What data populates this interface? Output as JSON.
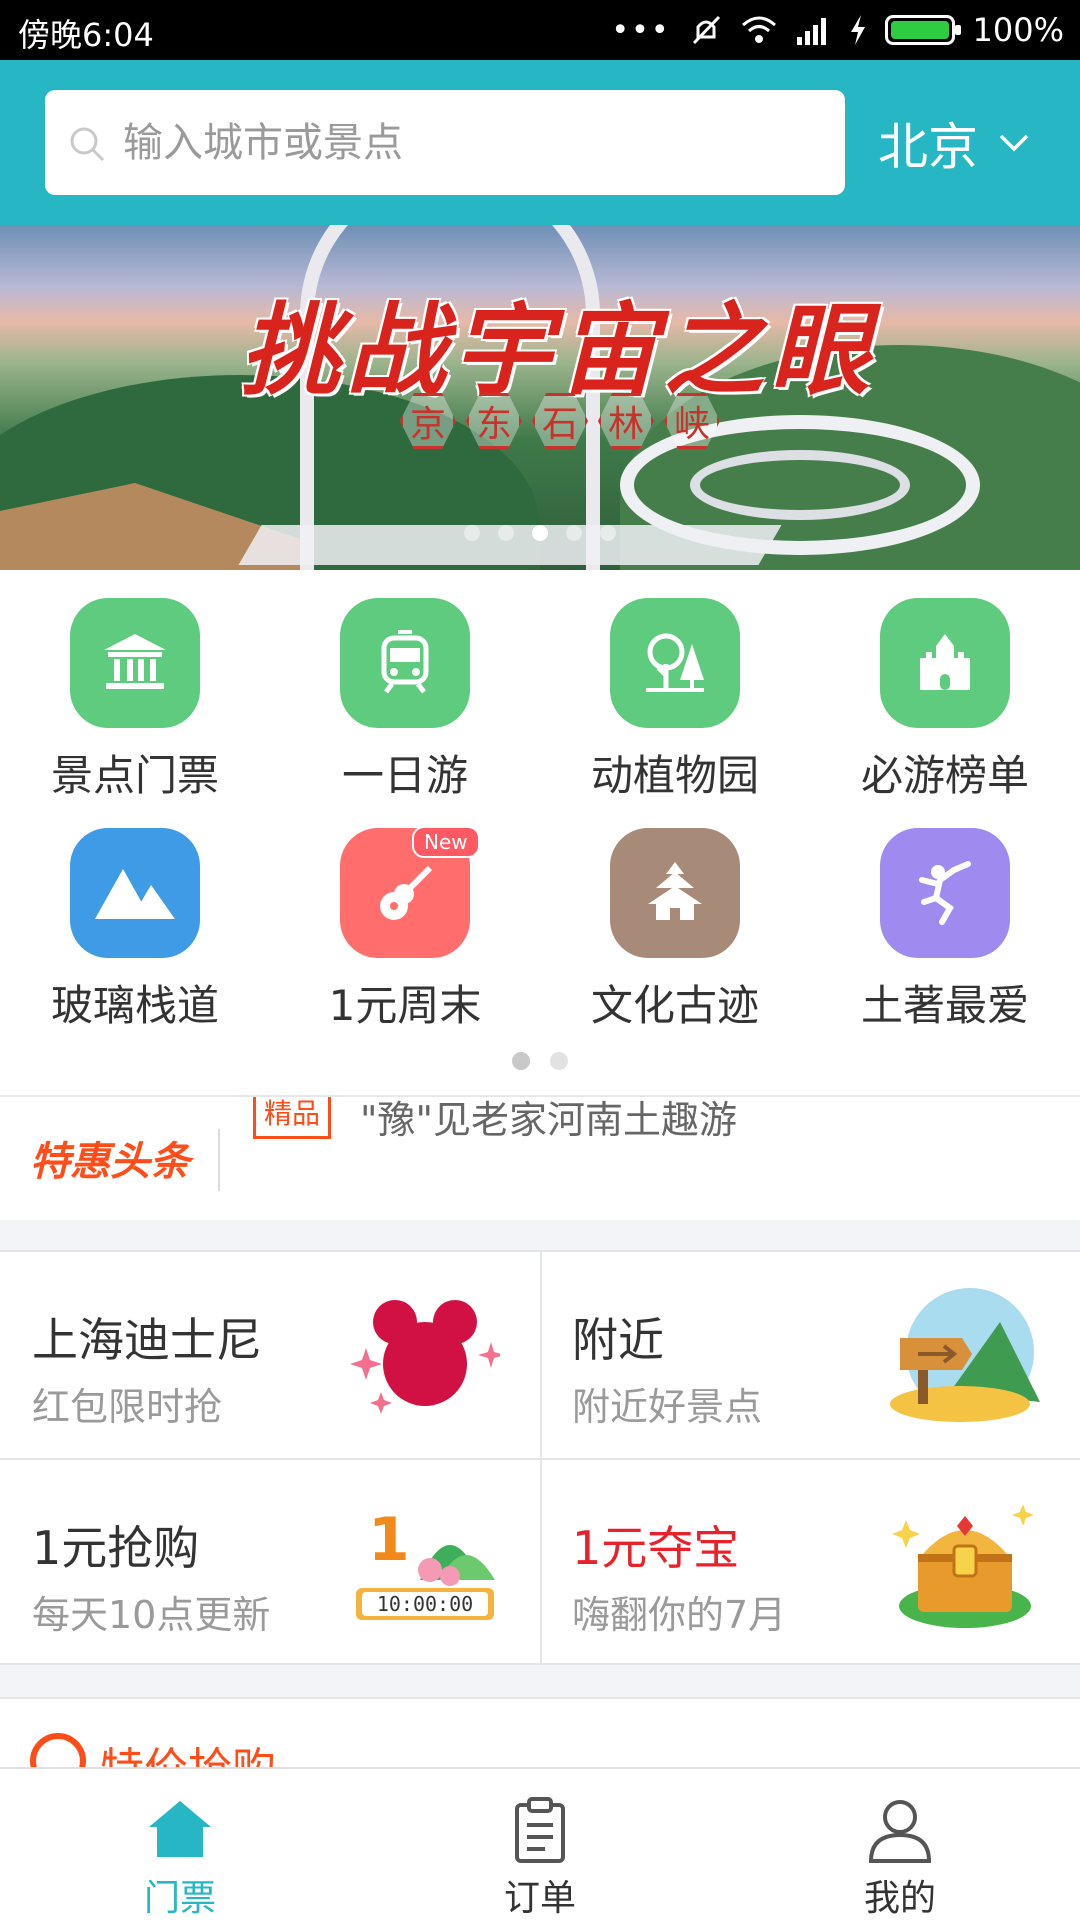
{
  "status_bar": {
    "time": "傍晚6:04",
    "signal_dots": "•••",
    "battery": "100%"
  },
  "header": {
    "search_placeholder": "输入城市或景点",
    "city": "北京"
  },
  "banner": {
    "title": "挑战宇宙之眼",
    "subtitle_chars": [
      "京",
      "东",
      "石",
      "林",
      "峡"
    ],
    "page_count": 5,
    "active_page": 3
  },
  "categories": [
    {
      "label": "景点门票",
      "icon": "temple-icon",
      "color": "#5ecb7e"
    },
    {
      "label": "一日游",
      "icon": "bus-icon",
      "color": "#5ecb7e"
    },
    {
      "label": "动植物园",
      "icon": "tree-icon",
      "color": "#5ecb7e"
    },
    {
      "label": "必游榜单",
      "icon": "castle-icon",
      "color": "#5ecb7e"
    },
    {
      "label": "玻璃栈道",
      "icon": "mountain-icon",
      "color": "#3f9be6"
    },
    {
      "label": "1元周末",
      "icon": "guitar-icon",
      "color": "#ff6d6d",
      "badge": "New"
    },
    {
      "label": "文化古迹",
      "icon": "pagoda-icon",
      "color": "#a88a78"
    },
    {
      "label": "土著最爱",
      "icon": "dancer-icon",
      "color": "#9f8bf0"
    }
  ],
  "grid_pager": {
    "pages": 2,
    "active": 1
  },
  "headline": {
    "brand": "特惠头条",
    "tag": "精品",
    "text": "\"豫\"见老家河南土趣游"
  },
  "promos": [
    {
      "title": "上海迪士尼",
      "subtitle": "红包限时抢",
      "icon": "mickey-icon",
      "title_color": "#333333"
    },
    {
      "title": "附近",
      "subtitle": "附近好景点",
      "icon": "signpost-icon",
      "title_color": "#333333"
    },
    {
      "title": "1元抢购",
      "subtitle": "每天10点更新",
      "icon": "timer-icon",
      "title_color": "#333333",
      "timer": "10:00:00"
    },
    {
      "title": "1元夺宝",
      "subtitle": "嗨翻你的7月",
      "icon": "treasure-chest-icon",
      "title_color": "#e8212a"
    }
  ],
  "section": {
    "title": "特价抢购"
  },
  "bottom_nav": [
    {
      "label": "门票",
      "icon": "home-icon",
      "active": true
    },
    {
      "label": "订单",
      "icon": "clipboard-icon",
      "active": false
    },
    {
      "label": "我的",
      "icon": "user-icon",
      "active": false
    }
  ],
  "colors": {
    "accent": "#26b6c4",
    "promo_red": "#ff4d1a"
  }
}
